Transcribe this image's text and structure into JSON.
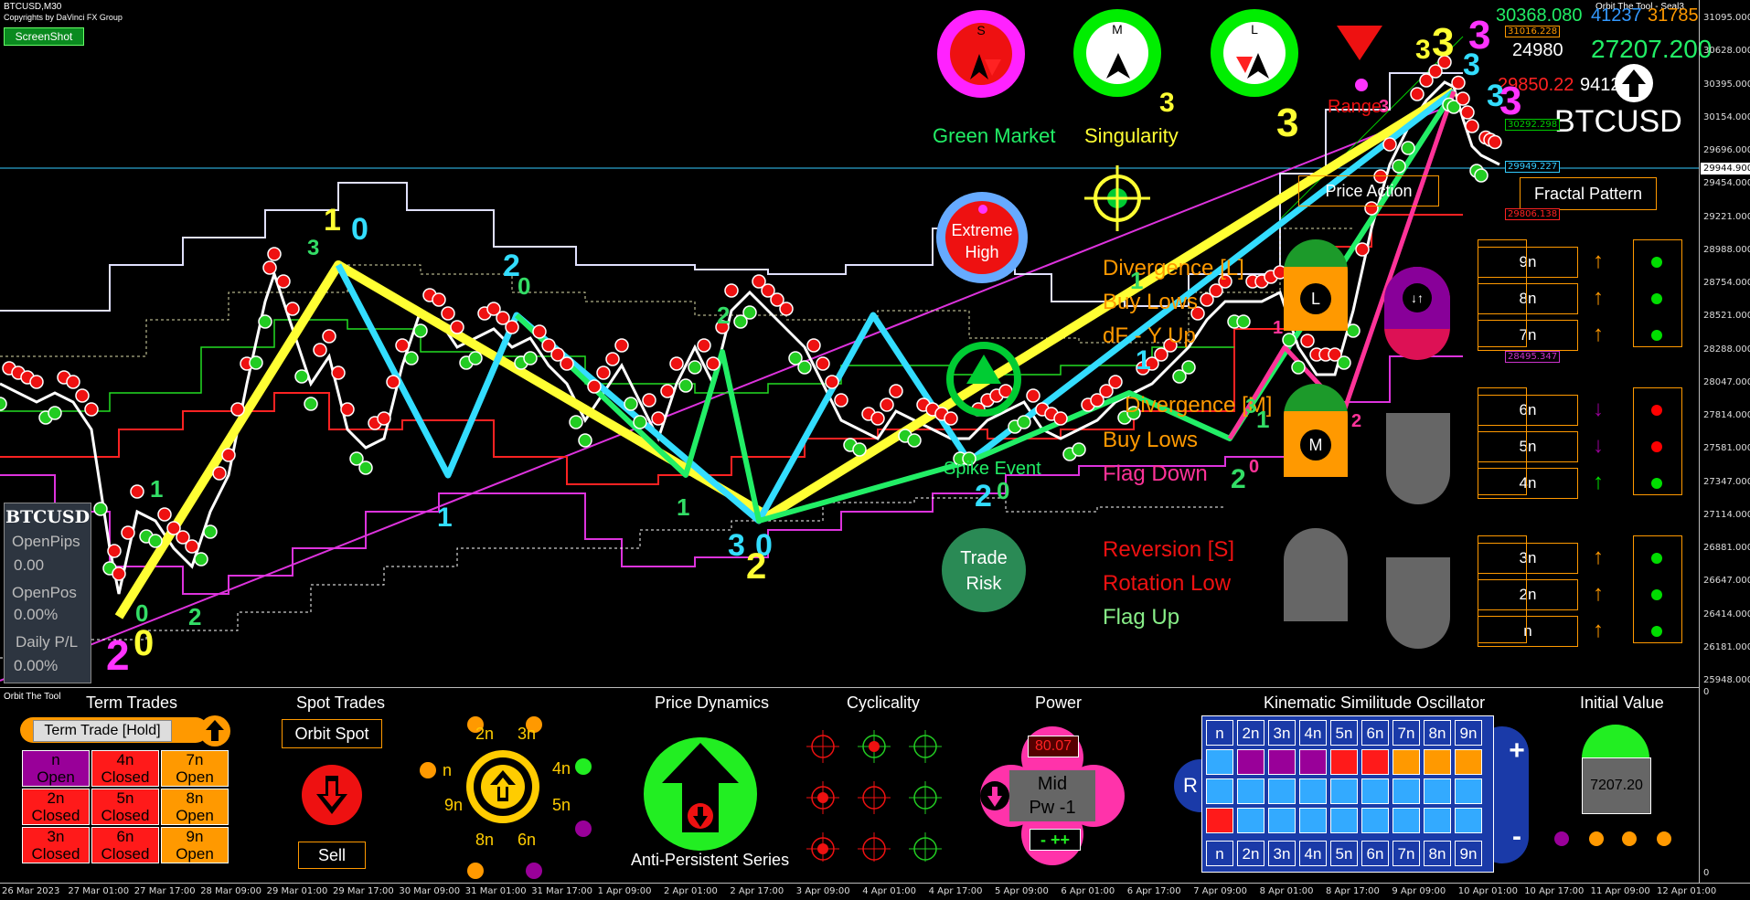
{
  "window": {
    "symbol_period": "BTCUSD,M30",
    "copyright": "Copyrights by DaVinci FX Group",
    "screenshot_button": "ScreenShot",
    "tool_name": "Orbit The Tool - Seal3",
    "subwindow_label": "Orbit The Tool"
  },
  "price_scale": {
    "ticks": [
      "31095.000",
      "30628.000",
      "30395.000",
      "30154.000",
      "29696.000",
      "29454.000",
      "29221.000",
      "28988.000",
      "28754.000",
      "28521.000",
      "28288.000",
      "28047.000",
      "27814.000",
      "27581.000",
      "27347.000",
      "27114.000",
      "26881.000",
      "26647.000",
      "26414.000",
      "26181.000",
      "25948.000"
    ],
    "tags": [
      {
        "text": "31016.228",
        "color": "#ff9900"
      },
      {
        "text": "30292.298",
        "color": "#00cc00"
      },
      {
        "text": "29949.227",
        "color": "#33ccff"
      },
      {
        "text": "29944.900",
        "color": "#ffffff"
      },
      {
        "text": "29806.138",
        "color": "#ff2222"
      },
      {
        "text": "28495.347",
        "color": "#cc33cc"
      }
    ],
    "sub_top": "0",
    "sub_bottom": "0"
  },
  "time_axis": [
    "26 Mar 2023",
    "27 Mar 01:00",
    "27 Mar 17:00",
    "28 Mar 09:00",
    "29 Mar 01:00",
    "29 Mar 17:00",
    "30 Mar 09:00",
    "31 Mar 01:00",
    "31 Mar 17:00",
    "1 Apr 09:00",
    "2 Apr 01:00",
    "2 Apr 17:00",
    "3 Apr 09:00",
    "4 Apr 01:00",
    "4 Apr 17:00",
    "5 Apr 09:00",
    "6 Apr 01:00",
    "6 Apr 17:00",
    "7 Apr 09:00",
    "8 Apr 01:00",
    "8 Apr 17:00",
    "9 Apr 09:00",
    "10 Apr 01:00",
    "10 Apr 17:00",
    "11 Apr 09:00",
    "12 Apr 01:00"
  ],
  "header_values": {
    "v1": "30368.080",
    "v2": "41237",
    "v3": "31785",
    "v4": "24980",
    "v5": "27207.200",
    "v6": "29850.22",
    "v7": "94129",
    "symbol": "BTCUSD",
    "digits_left": "3",
    "digits_mid": "3",
    "digits_right": "3",
    "digits_small": "3"
  },
  "compass": [
    {
      "letter": "S"
    },
    {
      "letter": "M"
    },
    {
      "letter": "L"
    }
  ],
  "labels": {
    "green_market": "Green Market",
    "singularity": "Singularity",
    "range": "Range",
    "price_action": "Price Action",
    "fractal_pattern": "Fractal Pattern",
    "extreme_high_1": "Extreme",
    "extreme_high_2": "High",
    "spike_event": "Spike Event",
    "trade_risk_1": "Trade",
    "trade_risk_2": "Risk",
    "divergence_l": "Divergence [L]",
    "buy_lows_1": "Buy Lows",
    "dfy_up": "dF - Y Up",
    "divergence_m": "Divergence [M]",
    "buy_lows_2": "Buy Lows",
    "flag_down": "Flag Down",
    "reversion_s": "Reversion [S]",
    "rotation_low": "Rotation Low",
    "flag_up": "Flag Up",
    "pill_l": "L",
    "pill_m": "M"
  },
  "n_rows": [
    {
      "label": "9n",
      "arrow": "↑",
      "arrow_color": "#ff9900",
      "dot": "#00dd00"
    },
    {
      "label": "8n",
      "arrow": "↑",
      "arrow_color": "#ff9900",
      "dot": "#00dd00"
    },
    {
      "label": "7n",
      "arrow": "↑",
      "arrow_color": "#ff9900",
      "dot": "#00dd00"
    },
    {
      "label": "6n",
      "arrow": "↓",
      "arrow_color": "#990099",
      "dot": "#ff0000"
    },
    {
      "label": "5n",
      "arrow": "↓",
      "arrow_color": "#990099",
      "dot": "#ff0000"
    },
    {
      "label": "4n",
      "arrow": "↑",
      "arrow_color": "#00dd00",
      "dot": "#00dd00"
    },
    {
      "label": "3n",
      "arrow": "↑",
      "arrow_color": "#ff9900",
      "dot": "#00dd00"
    },
    {
      "label": "2n",
      "arrow": "↑",
      "arrow_color": "#ff9900",
      "dot": "#00dd00"
    },
    {
      "label": "n",
      "arrow": "↑",
      "arrow_color": "#ff9900",
      "dot": "#00dd00"
    }
  ],
  "account": {
    "symbol": "BTCUSD",
    "open_pips_label": "OpenPips",
    "open_pips": "0.00",
    "open_pos_label": "OpenPos",
    "open_pos": "0.00%",
    "daily_pl_label": "Daily P/L",
    "daily_pl": "0.00%"
  },
  "chart_markers": [
    {
      "text": "1",
      "color": "#ffff33",
      "size": 34
    },
    {
      "text": "0",
      "color": "#33ddff",
      "size": 34
    },
    {
      "text": "3",
      "color": "#33dd66",
      "size": 24
    },
    {
      "text": "2",
      "color": "#33ddff",
      "size": 34
    },
    {
      "text": "0",
      "color": "#33dd66",
      "size": 26
    },
    {
      "text": "1",
      "color": "#33ddff",
      "size": 30
    },
    {
      "text": "2",
      "color": "#33dd66",
      "size": 26
    },
    {
      "text": "1",
      "color": "#33dd66",
      "size": 26
    },
    {
      "text": "1",
      "color": "#33dd66",
      "size": 26
    },
    {
      "text": "1",
      "color": "#33ddff",
      "size": 30
    },
    {
      "text": "1",
      "color": "#33dd66",
      "size": 26
    },
    {
      "text": "1",
      "color": "#33dd66",
      "size": 26
    },
    {
      "text": "3",
      "color": "#33ddff",
      "size": 34
    },
    {
      "text": "0",
      "color": "#33ddff",
      "size": 34
    },
    {
      "text": "2",
      "color": "#ffff33",
      "size": 40
    },
    {
      "text": "3",
      "color": "#33dd66",
      "size": 22
    },
    {
      "text": "2",
      "color": "#33ddff",
      "size": 34
    },
    {
      "text": "0",
      "color": "#33dd66",
      "size": 26
    },
    {
      "text": "2",
      "color": "#33dd66",
      "size": 30
    },
    {
      "text": "0",
      "color": "#ff3399",
      "size": 20
    },
    {
      "text": "1",
      "color": "#ff3399",
      "size": 20
    },
    {
      "text": "2",
      "color": "#ff3399",
      "size": 20
    },
    {
      "text": "2",
      "color": "#ff33ff",
      "size": 46
    },
    {
      "text": "0",
      "color": "#ffff33",
      "size": 40
    },
    {
      "text": "0",
      "color": "#33dd66",
      "size": 26
    },
    {
      "text": "2",
      "color": "#33dd66",
      "size": 26
    },
    {
      "text": "3",
      "color": "#ff3399",
      "size": 20
    },
    {
      "text": "3",
      "color": "#ffff33",
      "size": 30
    },
    {
      "text": "3",
      "color": "#ffff33",
      "size": 44
    },
    {
      "text": "3",
      "color": "#ff33ff",
      "size": 44
    },
    {
      "text": "3",
      "color": "#33ddff",
      "size": 34
    }
  ],
  "panel": {
    "term_trades": {
      "title": "Term Trades",
      "hold_button": "Term Trade [Hold]",
      "cells": [
        {
          "l1": "n",
          "l2": "Open",
          "bg": "#990099"
        },
        {
          "l1": "4n",
          "l2": "Closed",
          "bg": "#ff1a1a"
        },
        {
          "l1": "7n",
          "l2": "Open",
          "bg": "#ff9900"
        },
        {
          "l1": "2n",
          "l2": "Closed",
          "bg": "#ff1a1a"
        },
        {
          "l1": "5n",
          "l2": "Closed",
          "bg": "#ff1a1a"
        },
        {
          "l1": "8n",
          "l2": "Open",
          "bg": "#ff9900"
        },
        {
          "l1": "3n",
          "l2": "Closed",
          "bg": "#ff1a1a"
        },
        {
          "l1": "6n",
          "l2": "Closed",
          "bg": "#ff1a1a"
        },
        {
          "l1": "9n",
          "l2": "Open",
          "bg": "#ff9900"
        }
      ]
    },
    "spot_trades": {
      "title": "Spot Trades",
      "orbit_spot": "Orbit Spot",
      "sell": "Sell"
    },
    "orbit": {
      "labels": [
        "2n",
        "3n",
        "n",
        "4n",
        "9n",
        "5n",
        "8n",
        "6n"
      ]
    },
    "price_dynamics": {
      "title": "Price Dynamics",
      "series": "Anti-Persistent Series"
    },
    "cyclicality": {
      "title": "Cyclicality"
    },
    "power": {
      "title": "Power",
      "value": "80.07",
      "mid_1": "Mid",
      "mid_2": "Pw -1",
      "signs": "- ++"
    },
    "kso": {
      "title": "Kinematic Similitude Oscillator",
      "header": [
        "n",
        "2n",
        "3n",
        "4n",
        "5n",
        "6n",
        "7n",
        "8n",
        "9n"
      ],
      "rows": [
        [
          "#33aaff",
          "#990099",
          "#990099",
          "#990099",
          "#ff1a1a",
          "#ff1a1a",
          "#ff9900",
          "#ff9900",
          "#ff9900"
        ],
        [
          "#33aaff",
          "#33aaff",
          "#33aaff",
          "#33aaff",
          "#33aaff",
          "#33aaff",
          "#33aaff",
          "#33aaff",
          "#33aaff"
        ],
        [
          "#ff1a1a",
          "#33aaff",
          "#33aaff",
          "#33aaff",
          "#33aaff",
          "#33aaff",
          "#33aaff",
          "#33aaff",
          "#33aaff"
        ]
      ],
      "plus": "+",
      "minus": "-",
      "r": "R"
    },
    "initial_value": {
      "title": "Initial Value",
      "value": "7207.20"
    }
  }
}
